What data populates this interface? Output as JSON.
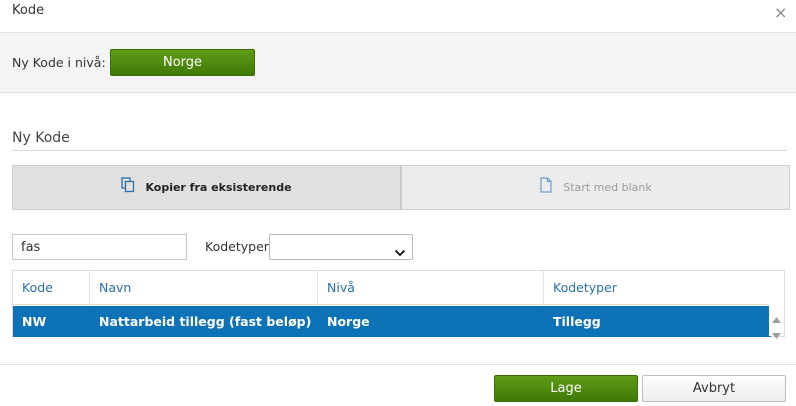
{
  "dialog": {
    "title": "Kode",
    "close_glyph": "×"
  },
  "level": {
    "label": "Ny Kode i nivå:",
    "button_label": "Norge"
  },
  "section": {
    "title": "Ny Kode"
  },
  "tabs": [
    {
      "label": "Kopier fra eksisterende",
      "icon": "copy-icon",
      "active": true
    },
    {
      "label": "Start med blank",
      "icon": "blank-document-icon",
      "active": false
    }
  ],
  "filters": {
    "search_value": "fas",
    "codetype_label": "Kodetyper",
    "codetype_selected": ""
  },
  "table": {
    "columns": [
      "Kode",
      "Navn",
      "Nivå",
      "Kodetyper"
    ],
    "rows": [
      {
        "kode": "NW",
        "navn": "Nattarbeid tillegg (fast beløp)",
        "niva": "Norge",
        "kodetyper": "Tillegg",
        "selected": true
      }
    ]
  },
  "footer": {
    "create_label": "Lage",
    "cancel_label": "Avbryt"
  },
  "colors": {
    "primary_green": "#4e8b0f",
    "selection_blue": "#0e73b6",
    "header_link_blue": "#2a6fa8"
  }
}
